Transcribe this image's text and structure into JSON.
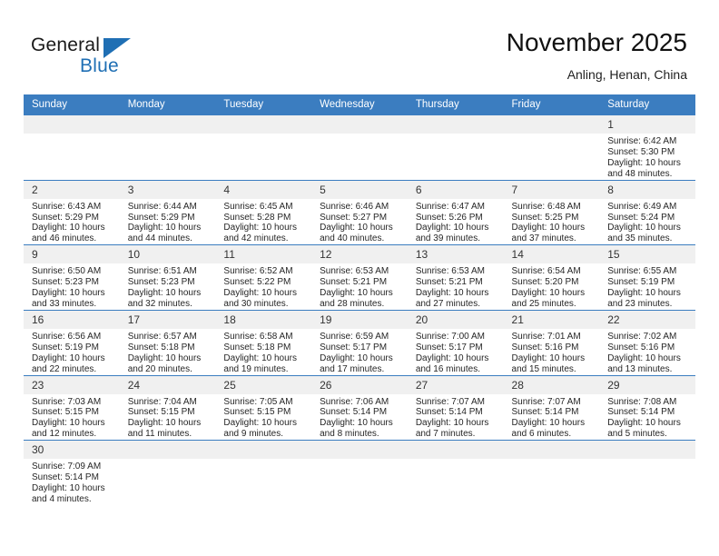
{
  "brand": {
    "name_top": "General",
    "name_bottom": "Blue",
    "accent_color": "#1f6fb4"
  },
  "header": {
    "month_title": "November 2025",
    "location": "Anling, Henan, China"
  },
  "calendar": {
    "header_bg": "#3b7dc0",
    "daynum_bg": "#f0f0f0",
    "weekday_headers": [
      "Sunday",
      "Monday",
      "Tuesday",
      "Wednesday",
      "Thursday",
      "Friday",
      "Saturday"
    ],
    "weeks": [
      [
        {
          "day": "",
          "sunrise": "",
          "sunset": "",
          "daylight_line1": "",
          "daylight_line2": ""
        },
        {
          "day": "",
          "sunrise": "",
          "sunset": "",
          "daylight_line1": "",
          "daylight_line2": ""
        },
        {
          "day": "",
          "sunrise": "",
          "sunset": "",
          "daylight_line1": "",
          "daylight_line2": ""
        },
        {
          "day": "",
          "sunrise": "",
          "sunset": "",
          "daylight_line1": "",
          "daylight_line2": ""
        },
        {
          "day": "",
          "sunrise": "",
          "sunset": "",
          "daylight_line1": "",
          "daylight_line2": ""
        },
        {
          "day": "",
          "sunrise": "",
          "sunset": "",
          "daylight_line1": "",
          "daylight_line2": ""
        },
        {
          "day": "1",
          "sunrise": "Sunrise: 6:42 AM",
          "sunset": "Sunset: 5:30 PM",
          "daylight_line1": "Daylight: 10 hours",
          "daylight_line2": "and 48 minutes."
        }
      ],
      [
        {
          "day": "2",
          "sunrise": "Sunrise: 6:43 AM",
          "sunset": "Sunset: 5:29 PM",
          "daylight_line1": "Daylight: 10 hours",
          "daylight_line2": "and 46 minutes."
        },
        {
          "day": "3",
          "sunrise": "Sunrise: 6:44 AM",
          "sunset": "Sunset: 5:29 PM",
          "daylight_line1": "Daylight: 10 hours",
          "daylight_line2": "and 44 minutes."
        },
        {
          "day": "4",
          "sunrise": "Sunrise: 6:45 AM",
          "sunset": "Sunset: 5:28 PM",
          "daylight_line1": "Daylight: 10 hours",
          "daylight_line2": "and 42 minutes."
        },
        {
          "day": "5",
          "sunrise": "Sunrise: 6:46 AM",
          "sunset": "Sunset: 5:27 PM",
          "daylight_line1": "Daylight: 10 hours",
          "daylight_line2": "and 40 minutes."
        },
        {
          "day": "6",
          "sunrise": "Sunrise: 6:47 AM",
          "sunset": "Sunset: 5:26 PM",
          "daylight_line1": "Daylight: 10 hours",
          "daylight_line2": "and 39 minutes."
        },
        {
          "day": "7",
          "sunrise": "Sunrise: 6:48 AM",
          "sunset": "Sunset: 5:25 PM",
          "daylight_line1": "Daylight: 10 hours",
          "daylight_line2": "and 37 minutes."
        },
        {
          "day": "8",
          "sunrise": "Sunrise: 6:49 AM",
          "sunset": "Sunset: 5:24 PM",
          "daylight_line1": "Daylight: 10 hours",
          "daylight_line2": "and 35 minutes."
        }
      ],
      [
        {
          "day": "9",
          "sunrise": "Sunrise: 6:50 AM",
          "sunset": "Sunset: 5:23 PM",
          "daylight_line1": "Daylight: 10 hours",
          "daylight_line2": "and 33 minutes."
        },
        {
          "day": "10",
          "sunrise": "Sunrise: 6:51 AM",
          "sunset": "Sunset: 5:23 PM",
          "daylight_line1": "Daylight: 10 hours",
          "daylight_line2": "and 32 minutes."
        },
        {
          "day": "11",
          "sunrise": "Sunrise: 6:52 AM",
          "sunset": "Sunset: 5:22 PM",
          "daylight_line1": "Daylight: 10 hours",
          "daylight_line2": "and 30 minutes."
        },
        {
          "day": "12",
          "sunrise": "Sunrise: 6:53 AM",
          "sunset": "Sunset: 5:21 PM",
          "daylight_line1": "Daylight: 10 hours",
          "daylight_line2": "and 28 minutes."
        },
        {
          "day": "13",
          "sunrise": "Sunrise: 6:53 AM",
          "sunset": "Sunset: 5:21 PM",
          "daylight_line1": "Daylight: 10 hours",
          "daylight_line2": "and 27 minutes."
        },
        {
          "day": "14",
          "sunrise": "Sunrise: 6:54 AM",
          "sunset": "Sunset: 5:20 PM",
          "daylight_line1": "Daylight: 10 hours",
          "daylight_line2": "and 25 minutes."
        },
        {
          "day": "15",
          "sunrise": "Sunrise: 6:55 AM",
          "sunset": "Sunset: 5:19 PM",
          "daylight_line1": "Daylight: 10 hours",
          "daylight_line2": "and 23 minutes."
        }
      ],
      [
        {
          "day": "16",
          "sunrise": "Sunrise: 6:56 AM",
          "sunset": "Sunset: 5:19 PM",
          "daylight_line1": "Daylight: 10 hours",
          "daylight_line2": "and 22 minutes."
        },
        {
          "day": "17",
          "sunrise": "Sunrise: 6:57 AM",
          "sunset": "Sunset: 5:18 PM",
          "daylight_line1": "Daylight: 10 hours",
          "daylight_line2": "and 20 minutes."
        },
        {
          "day": "18",
          "sunrise": "Sunrise: 6:58 AM",
          "sunset": "Sunset: 5:18 PM",
          "daylight_line1": "Daylight: 10 hours",
          "daylight_line2": "and 19 minutes."
        },
        {
          "day": "19",
          "sunrise": "Sunrise: 6:59 AM",
          "sunset": "Sunset: 5:17 PM",
          "daylight_line1": "Daylight: 10 hours",
          "daylight_line2": "and 17 minutes."
        },
        {
          "day": "20",
          "sunrise": "Sunrise: 7:00 AM",
          "sunset": "Sunset: 5:17 PM",
          "daylight_line1": "Daylight: 10 hours",
          "daylight_line2": "and 16 minutes."
        },
        {
          "day": "21",
          "sunrise": "Sunrise: 7:01 AM",
          "sunset": "Sunset: 5:16 PM",
          "daylight_line1": "Daylight: 10 hours",
          "daylight_line2": "and 15 minutes."
        },
        {
          "day": "22",
          "sunrise": "Sunrise: 7:02 AM",
          "sunset": "Sunset: 5:16 PM",
          "daylight_line1": "Daylight: 10 hours",
          "daylight_line2": "and 13 minutes."
        }
      ],
      [
        {
          "day": "23",
          "sunrise": "Sunrise: 7:03 AM",
          "sunset": "Sunset: 5:15 PM",
          "daylight_line1": "Daylight: 10 hours",
          "daylight_line2": "and 12 minutes."
        },
        {
          "day": "24",
          "sunrise": "Sunrise: 7:04 AM",
          "sunset": "Sunset: 5:15 PM",
          "daylight_line1": "Daylight: 10 hours",
          "daylight_line2": "and 11 minutes."
        },
        {
          "day": "25",
          "sunrise": "Sunrise: 7:05 AM",
          "sunset": "Sunset: 5:15 PM",
          "daylight_line1": "Daylight: 10 hours",
          "daylight_line2": "and 9 minutes."
        },
        {
          "day": "26",
          "sunrise": "Sunrise: 7:06 AM",
          "sunset": "Sunset: 5:14 PM",
          "daylight_line1": "Daylight: 10 hours",
          "daylight_line2": "and 8 minutes."
        },
        {
          "day": "27",
          "sunrise": "Sunrise: 7:07 AM",
          "sunset": "Sunset: 5:14 PM",
          "daylight_line1": "Daylight: 10 hours",
          "daylight_line2": "and 7 minutes."
        },
        {
          "day": "28",
          "sunrise": "Sunrise: 7:07 AM",
          "sunset": "Sunset: 5:14 PM",
          "daylight_line1": "Daylight: 10 hours",
          "daylight_line2": "and 6 minutes."
        },
        {
          "day": "29",
          "sunrise": "Sunrise: 7:08 AM",
          "sunset": "Sunset: 5:14 PM",
          "daylight_line1": "Daylight: 10 hours",
          "daylight_line2": "and 5 minutes."
        }
      ],
      [
        {
          "day": "30",
          "sunrise": "Sunrise: 7:09 AM",
          "sunset": "Sunset: 5:14 PM",
          "daylight_line1": "Daylight: 10 hours",
          "daylight_line2": "and 4 minutes."
        },
        {
          "day": "",
          "sunrise": "",
          "sunset": "",
          "daylight_line1": "",
          "daylight_line2": ""
        },
        {
          "day": "",
          "sunrise": "",
          "sunset": "",
          "daylight_line1": "",
          "daylight_line2": ""
        },
        {
          "day": "",
          "sunrise": "",
          "sunset": "",
          "daylight_line1": "",
          "daylight_line2": ""
        },
        {
          "day": "",
          "sunrise": "",
          "sunset": "",
          "daylight_line1": "",
          "daylight_line2": ""
        },
        {
          "day": "",
          "sunrise": "",
          "sunset": "",
          "daylight_line1": "",
          "daylight_line2": ""
        },
        {
          "day": "",
          "sunrise": "",
          "sunset": "",
          "daylight_line1": "",
          "daylight_line2": ""
        }
      ]
    ]
  }
}
